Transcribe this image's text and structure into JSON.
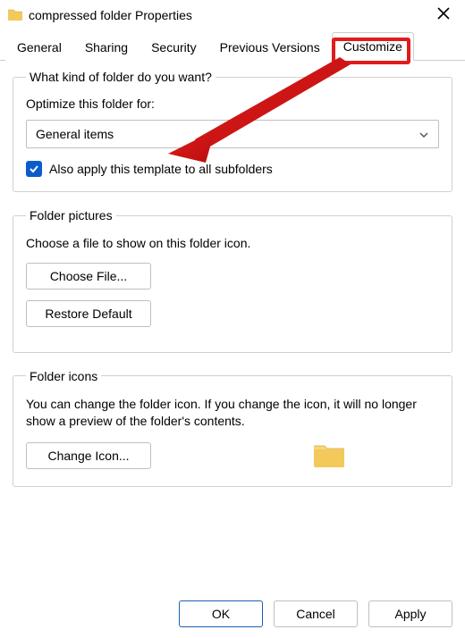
{
  "window": {
    "title": "compressed folder Properties"
  },
  "tabs": {
    "general": "General",
    "sharing": "Sharing",
    "security": "Security",
    "previous": "Previous Versions",
    "customize": "Customize"
  },
  "group_kind": {
    "legend": "What kind of folder do you want?",
    "optimize_label": "Optimize this folder for:",
    "select_value": "General items",
    "apply_subfolders": "Also apply this template to all subfolders"
  },
  "group_pictures": {
    "legend": "Folder pictures",
    "desc": "Choose a file to show on this folder icon.",
    "choose_file": "Choose File...",
    "restore_default": "Restore Default"
  },
  "group_icons": {
    "legend": "Folder icons",
    "desc": "You can change the folder icon. If you change the icon, it will no longer show a preview of the folder's contents.",
    "change_icon": "Change Icon..."
  },
  "footer": {
    "ok": "OK",
    "cancel": "Cancel",
    "apply": "Apply"
  }
}
